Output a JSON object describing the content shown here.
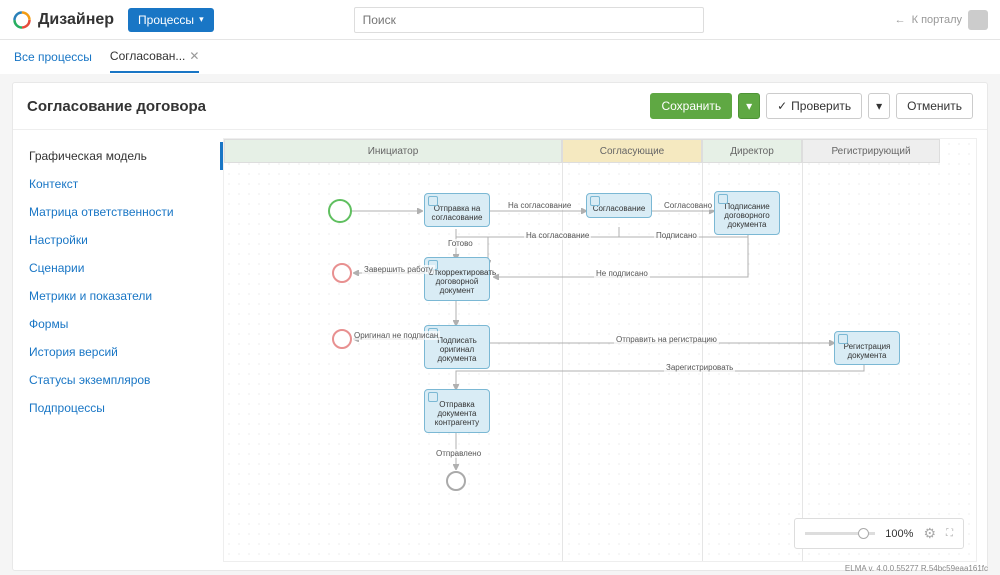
{
  "app": {
    "name": "Дизайнер",
    "processes_btn": "Процессы",
    "search_ph": "Поиск",
    "portal": "К порталу"
  },
  "tabs": {
    "all": "Все процессы",
    "current": "Согласован..."
  },
  "page": {
    "title": "Согласование договора"
  },
  "actions": {
    "save": "Сохранить",
    "check": "Проверить",
    "cancel": "Отменить"
  },
  "sidebar": {
    "items": [
      "Графическая модель",
      "Контекст",
      "Матрица ответственности",
      "Настройки",
      "Сценарии",
      "Метрики и показатели",
      "Формы",
      "История версий",
      "Статусы экземпляров",
      "Подпроцессы"
    ]
  },
  "lanes": {
    "l1": "Инициатор",
    "l2": "Согласующие",
    "l3": "Директор",
    "l4": "Регистрирующий"
  },
  "nodes": {
    "send_approval": "Отправка на согласование",
    "approval": "Согласование",
    "sign_dir": "Подписание договорного документа",
    "correct": "Откорректировать договорной документ",
    "sign_orig": "Подписать оригинал документа",
    "send_contr": "Отправка документа контрагенту",
    "register": "Регистрация документа"
  },
  "labels": {
    "to_approval": "На согласование",
    "approved": "Согласовано",
    "not_approved": "На согласование",
    "signed": "Подписано",
    "ready": "Готово",
    "finish": "Завершить работу",
    "not_signed": "Не подписано",
    "orig_not_signed": "Оригинал не подписан",
    "send_reg": "Отправить на регистрацию",
    "registered": "Зарегистрировать",
    "sent": "Отправлено"
  },
  "zoom": "100%",
  "version": "ELMA v. 4.0.0.55277 R.54bc59eaa161fc"
}
